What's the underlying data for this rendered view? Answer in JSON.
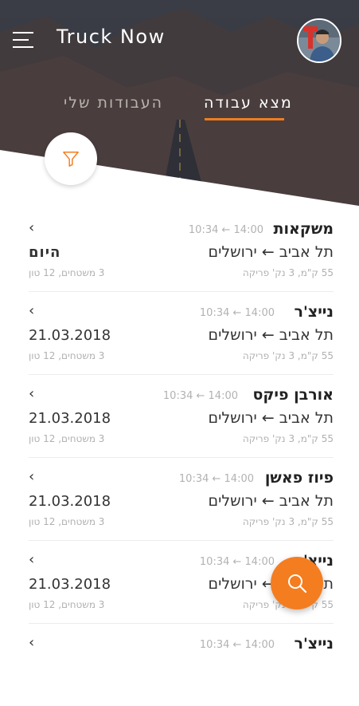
{
  "app": {
    "title": "Truck Now"
  },
  "tabs": {
    "find_work": "מצא עבודה",
    "my_work": "העבודות שלי"
  },
  "colors": {
    "accent": "#f47d20",
    "header_dark": "#3b3f48"
  },
  "icons": {
    "menu": "menu-icon",
    "filter": "filter-icon",
    "search": "search-icon",
    "chevron": "chevron-left-icon"
  },
  "jobs": [
    {
      "company": "משקאות",
      "times": "10:34 ← 14:00",
      "route": "תל אביב ← ירושלים",
      "date": "היום",
      "details": "55 ק\"מ, 3 נק' פריקה",
      "load": "3 משטחים, 12 טון"
    },
    {
      "company": "נייצ'ר",
      "times": "10:34 ← 14:00",
      "route": "תל אביב ← ירושלים",
      "date": "21.03.2018",
      "details": "55 ק\"מ, 3 נק' פריקה",
      "load": "3 משטחים, 12 טון"
    },
    {
      "company": "אורבן פיקס",
      "times": "10:34 ← 14:00",
      "route": "תל אביב ← ירושלים",
      "date": "21.03.2018",
      "details": "55 ק\"מ, 3 נק' פריקה",
      "load": "3 משטחים, 12 טון"
    },
    {
      "company": "פיוז פאשן",
      "times": "10:34 ← 14:00",
      "route": "תל אביב ← ירושלים",
      "date": "21.03.2018",
      "details": "55 ק\"מ, 3 נק' פריקה",
      "load": "3 משטחים, 12 טון"
    },
    {
      "company": "נייצ'ר",
      "times": "10:34 ← 14:00",
      "route": "תל אביב ← ירושלים",
      "date": "21.03.2018",
      "details": "55 ק\"מ, 3 נק' פריקה",
      "load": "3 משטחים, 12 טון"
    },
    {
      "company": "נייצ'ר",
      "times": "10:34 ← 14:00",
      "route": "",
      "date": "",
      "details": "",
      "load": ""
    }
  ]
}
